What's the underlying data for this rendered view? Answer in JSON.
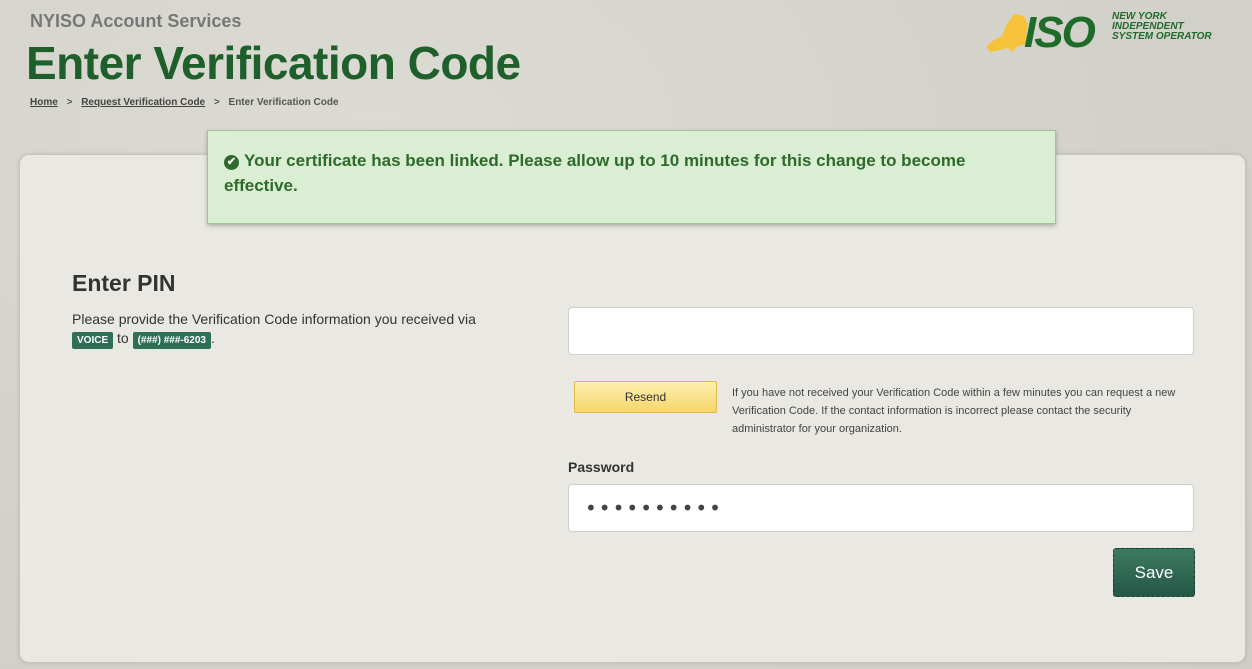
{
  "header": {
    "app_name": "NYISO Account Services",
    "page_title": "Enter Verification Code",
    "breadcrumb": [
      {
        "label": "Home"
      },
      {
        "label": "Request Verification Code"
      },
      {
        "label": "Enter Verification Code"
      }
    ],
    "breadcrumb_separator": ">"
  },
  "logo": {
    "mark": "ISO",
    "org_lines": [
      "NEW YORK",
      "INDEPENDENT",
      "SYSTEM OPERATOR"
    ]
  },
  "alert": {
    "icon": "check-circle-icon",
    "text": "Your certificate has been linked. Please allow up to 10 minutes for this change to become effective."
  },
  "pin_section": {
    "heading": "Enter PIN",
    "desc_prefix": "Please provide the Verification Code information you received via",
    "method": "VOICE",
    "to_word": "to",
    "phone": "(###) ###-6203",
    "desc_suffix": ".",
    "pin_value": "",
    "pin_placeholder": ""
  },
  "resend": {
    "label": "Resend",
    "note": "If you have not received your Verification Code within a few minutes you can request a new Verification Code. If the contact information is incorrect please contact the security administrator for your organization."
  },
  "password": {
    "label": "Password",
    "masked_value": "••••••••••"
  },
  "save": {
    "label": "Save"
  },
  "colors": {
    "title_green": "#1e5f2c",
    "alert_bg": "#d9eed2",
    "alert_text": "#2e6b2b",
    "tag_bg": "#2f6f58",
    "resend_bg": "#f6d66b",
    "save_bg": "#2d6a54"
  }
}
